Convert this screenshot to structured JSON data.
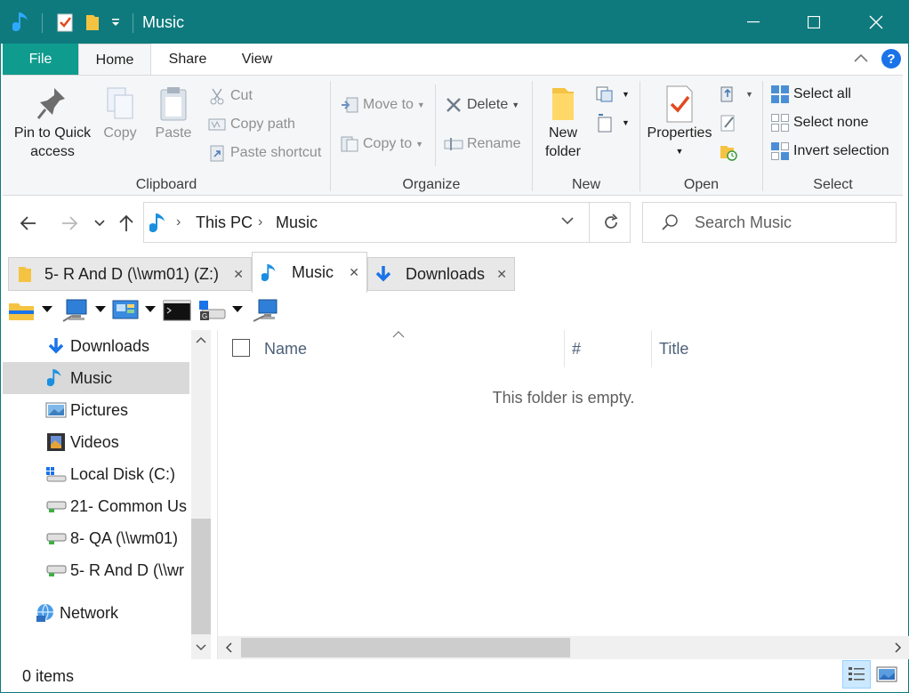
{
  "window": {
    "title": "Music"
  },
  "ribbon_tabs": [
    "File",
    "Home",
    "Share",
    "View"
  ],
  "ribbon": {
    "clipboard": {
      "label": "Clipboard",
      "pin": "Pin to Quick\naccess",
      "pin_line1": "Pin to Quick",
      "pin_line2": "access",
      "copy": "Copy",
      "paste": "Paste",
      "cut": "Cut",
      "copy_path": "Copy path",
      "paste_shortcut": "Paste shortcut"
    },
    "organize": {
      "label": "Organize",
      "move_to": "Move to",
      "copy_to": "Copy to",
      "delete": "Delete",
      "rename": "Rename"
    },
    "new": {
      "label": "New",
      "new_folder_line1": "New",
      "new_folder_line2": "folder"
    },
    "open": {
      "label": "Open",
      "properties": "Properties"
    },
    "select": {
      "label": "Select",
      "select_all": "Select all",
      "select_none": "Select none",
      "invert": "Invert selection"
    }
  },
  "address": {
    "crumbs": [
      "This PC",
      "Music"
    ]
  },
  "search": {
    "placeholder": "Search Music"
  },
  "folder_tabs": [
    {
      "label": "5- R And D (\\\\wm01) (Z:)",
      "icon": "folder-icon"
    },
    {
      "label": "Music",
      "icon": "music-note-icon",
      "active": true
    },
    {
      "label": "Downloads",
      "icon": "download-arrow-icon"
    }
  ],
  "nav_pane": {
    "items": [
      {
        "label": "Downloads",
        "icon": "download-arrow-icon"
      },
      {
        "label": "Music",
        "icon": "music-note-icon",
        "selected": true
      },
      {
        "label": "Pictures",
        "icon": "pictures-icon"
      },
      {
        "label": "Videos",
        "icon": "videos-icon"
      },
      {
        "label": "Local Disk (C:)",
        "icon": "local-disk-icon"
      },
      {
        "label": "21- Common Us",
        "icon": "network-drive-icon"
      },
      {
        "label": "8- QA (\\\\wm01)",
        "icon": "network-drive-icon"
      },
      {
        "label": "5- R And D (\\\\wr",
        "icon": "network-drive-icon"
      },
      {
        "label": "Network",
        "icon": "network-icon"
      }
    ]
  },
  "content": {
    "columns": [
      "Name",
      "#",
      "Title"
    ],
    "empty_message": "This folder is empty."
  },
  "status": {
    "items": "0 items"
  },
  "colors": {
    "title_bar": "#0f7a7d",
    "file_tab": "#0f9b8e",
    "selected_nav": "#d9d9d9",
    "accent_blue": "#1a73e8"
  }
}
